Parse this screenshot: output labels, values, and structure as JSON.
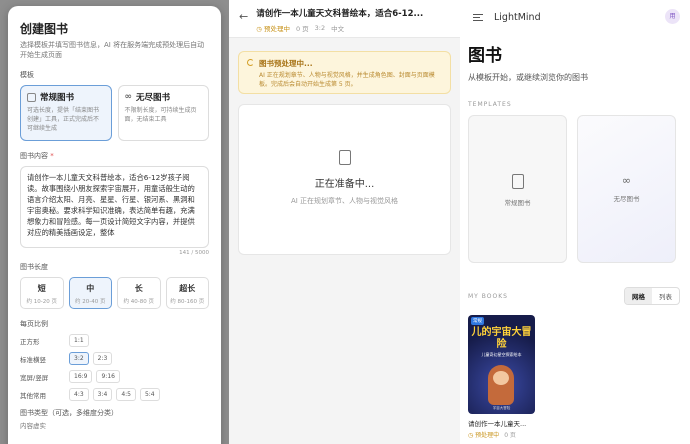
{
  "modal": {
    "title": "创建图书",
    "subtitle": "选择模板并填写图书信息，AI 将在服务端完成预处理后自动开始生成页面",
    "template_label": "模板",
    "templates": [
      {
        "name": "常规图书",
        "desc": "可选长度，提供「结束图书创建」工具，正式完成后不可继续生成",
        "icon": "book-icon"
      },
      {
        "name": "无尽图书",
        "desc": "不限制长度，可持续生成页面，无结束工具",
        "icon": "infinity-icon"
      }
    ],
    "content_label": "图书内容",
    "required_mark": "*",
    "content_text": "请创作一本儿童天文科普绘本，适合6-12岁孩子阅读。故事围绕小朋友探索宇宙展开，用童话般生动的语言介绍太阳、月亮、星星、行星、银河系、黑洞和宇宙奥秘。要求科学知识准确，表达简单有趣，充满想象力和冒险感。每一页设计简短文字内容，并提供对应的精美插画设定，整体",
    "char_count": "141 / 5000",
    "length_label": "图书长度",
    "lengths": [
      {
        "name": "短",
        "range": "约 10-20 页"
      },
      {
        "name": "中",
        "range": "约 20-40 页"
      },
      {
        "name": "长",
        "range": "约 40-80 页"
      },
      {
        "name": "超长",
        "range": "约 80-160 页"
      }
    ],
    "ratio_label": "每页比例",
    "ratio_rows": [
      {
        "label": "正方形",
        "options": [
          "1:1"
        ]
      },
      {
        "label": "标准横竖",
        "options": [
          "3:2",
          "2:3"
        ]
      },
      {
        "label": "宽屏/竖屏",
        "options": [
          "16:9",
          "9:16"
        ]
      },
      {
        "label": "其他常用",
        "options": [
          "4:3",
          "3:4",
          "4:5",
          "5:4"
        ]
      }
    ],
    "type_label": "图书类型（可选，多维度分类）",
    "type_sub": "内容虚实"
  },
  "middle": {
    "title": "请创作一本儿童天文科普绘本，适合6-12...",
    "status": "预处理中",
    "pages": "0 页",
    "ratio": "3:2",
    "lang": "中文",
    "notice_title": "图书预处理中...",
    "notice_desc": "AI 正在规划章节、人物与视觉风格，并生成角色图、封面与页面模板。完成后会自动开始生成第 5 页。",
    "prep_title": "正在准备中...",
    "prep_desc": "AI 正在规划章节、人物与视觉风格"
  },
  "right": {
    "brand": "LightMind",
    "avatar": "用",
    "heading": "图书",
    "subheading": "从模板开始，或继续浏览你的图书",
    "templates_label": "TEMPLATES",
    "templates": [
      "常规图书",
      "无尽图书"
    ],
    "mybooks_label": "MY BOOKS",
    "view_grid": "网格",
    "view_list": "列表",
    "book": {
      "badge": "常规",
      "cover_title": "儿的宇宙大冒险",
      "cover_sub": "儿童奇幻星空探索绘本",
      "cover_footer": "宇宙大冒险",
      "title": "请创作一本儿童天...",
      "status": "预处理中",
      "pages": "0 页"
    }
  },
  "colors": {
    "accent": "#6b9ed8",
    "warning": "#c8931a",
    "highlight": "#f29d62"
  }
}
